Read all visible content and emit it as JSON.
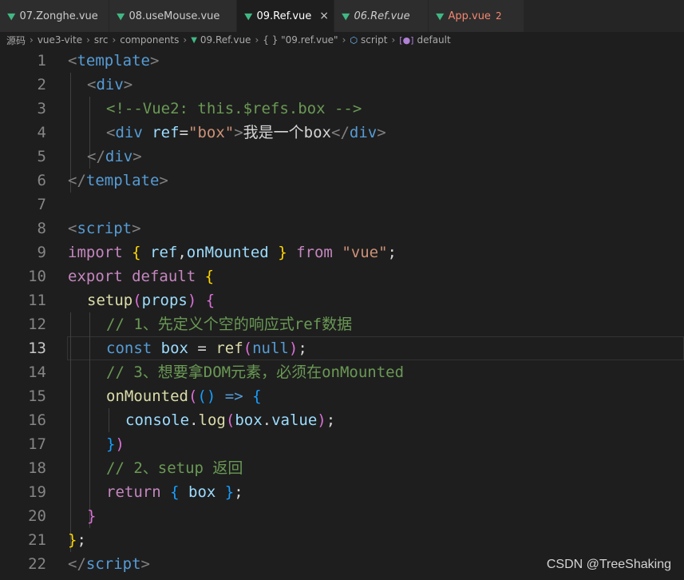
{
  "tabs": [
    {
      "label": "07.Zonghe.vue",
      "active": false
    },
    {
      "label": "08.useMouse.vue",
      "active": false
    },
    {
      "label": "09.Ref.vue",
      "active": true,
      "close": "×"
    },
    {
      "label": "06.Ref.vue",
      "active": false
    },
    {
      "label": "App.vue",
      "active": false,
      "badge": "2"
    }
  ],
  "breadcrumb": {
    "root": "源码",
    "p1": "vue3-vite",
    "p2": "src",
    "p3": "components",
    "p4": "09.Ref.vue",
    "p5": "{ } \"09.ref.vue\"",
    "p6": "script",
    "p7": "default"
  },
  "line_numbers": [
    "1",
    "2",
    "3",
    "4",
    "5",
    "6",
    "7",
    "8",
    "9",
    "10",
    "11",
    "12",
    "13",
    "14",
    "15",
    "16",
    "17",
    "18",
    "19",
    "20",
    "21",
    "22"
  ],
  "current_line": 13,
  "code": {
    "l1": [
      "<",
      "template",
      ">"
    ],
    "l2": [
      "<",
      "div",
      ">"
    ],
    "l3": "<!--Vue2: this.$refs.box -->",
    "l4": [
      "<",
      "div",
      " ",
      "ref",
      "=",
      "\"box\"",
      ">",
      "我是一个box",
      "</",
      "div",
      ">"
    ],
    "l5": [
      "</",
      "div",
      ">"
    ],
    "l6": [
      "</",
      "template",
      ">"
    ],
    "l8": [
      "<",
      "script",
      ">"
    ],
    "l9": [
      "import",
      " ",
      "{",
      " ",
      "ref",
      ",",
      "onMounted",
      " ",
      "}",
      " ",
      "from",
      " ",
      "\"vue\"",
      ";"
    ],
    "l10": [
      "export",
      " ",
      "default",
      " ",
      "{"
    ],
    "l11": [
      "setup",
      "(",
      "props",
      ")",
      " ",
      "{"
    ],
    "l12": "// 1、先定义个空的响应式ref数据",
    "l13": [
      "const",
      " ",
      "box",
      " = ",
      "ref",
      "(",
      "null",
      ")",
      ";"
    ],
    "l14": "// 3、想要拿DOM元素，必须在onMounted",
    "l15": [
      "onMounted",
      "(",
      "()",
      " ",
      "=>",
      " ",
      "{"
    ],
    "l16": [
      "console",
      ".",
      "log",
      "(",
      "box",
      ".",
      "value",
      ")",
      ";"
    ],
    "l17": [
      "}",
      ")"
    ],
    "l18": "// 2、setup 返回",
    "l19": [
      "return",
      " ",
      "{",
      " ",
      "box",
      " ",
      "}",
      ";"
    ],
    "l20": [
      "}"
    ],
    "l21": [
      "}",
      ";"
    ],
    "l22": [
      "</",
      "script",
      ">"
    ]
  },
  "watermark": "CSDN @TreeShaking"
}
